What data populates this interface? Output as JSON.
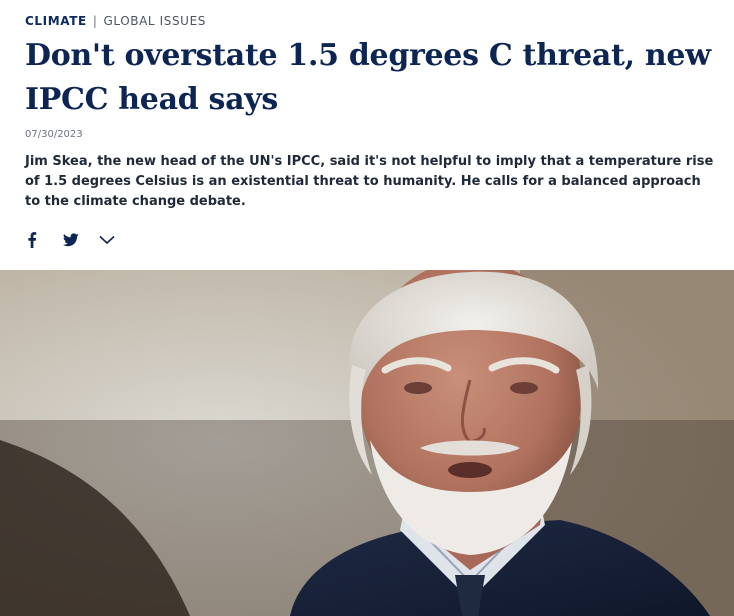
{
  "kicker": {
    "category": "CLIMATE",
    "separator": "|",
    "subcategory": "GLOBAL ISSUES"
  },
  "article": {
    "title": "Don't overstate 1.5 degrees C threat, new IPCC head says",
    "date": "07/30/2023",
    "teaser": "Jim Skea, the new head of the UN's IPCC, said it's not helpful to imply that a temperature rise of 1.5 degrees Celsius is an existential threat to humanity. He calls for a balanced approach to the climate change debate."
  },
  "share": {
    "icons": [
      "facebook-icon",
      "twitter-icon",
      "chevron-down-icon"
    ]
  },
  "colors": {
    "brand_navy": "#0c2552",
    "text_gray": "#6b7280"
  }
}
